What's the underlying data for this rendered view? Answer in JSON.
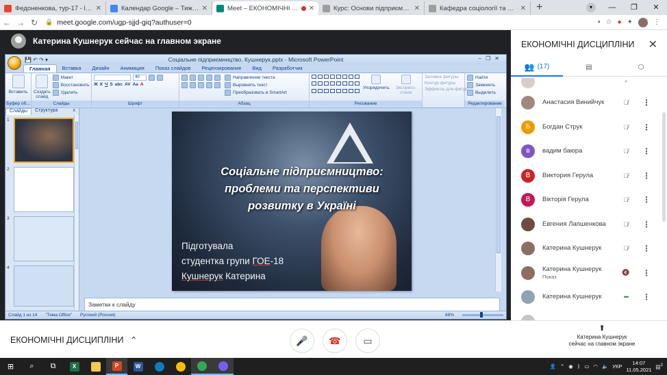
{
  "browser": {
    "tabs": [
      {
        "title": "Федоненкова, тур-17 - ludmila.b",
        "color": "#ea4335",
        "active": false
      },
      {
        "title": "Календар Google – Тиждень (10",
        "color": "#4285f4",
        "active": false
      },
      {
        "title": "Meet – ЕКОНОМІЧНІ ДИСЦ",
        "color": "#00897b",
        "active": true
      },
      {
        "title": "Курс: Основи підприємницької",
        "color": "#9e9e9e",
        "active": false
      },
      {
        "title": "Кафедра соціології та масових",
        "color": "#9e9e9e",
        "active": false
      }
    ],
    "new_tab": "+",
    "url": "meet.google.com/ugp-sjjd-giq?authuser=0"
  },
  "meet": {
    "presenter_banner": "Катерина Кушнерук сейчас на главном экране",
    "meeting_name": "ЕКОНОМІЧНІ ДИСЦИПЛІНИ",
    "present_label_line1": "Катерина Кушнерук",
    "present_label_line2": "сейчас на главном экране"
  },
  "ppt": {
    "window_title": "Соціальне підприємництво. Кушнерук.pptx - Microsoft PowerPoint",
    "tabs": [
      "Главная",
      "Вставка",
      "Дизайн",
      "Анимация",
      "Показ слайдов",
      "Рецензирование",
      "Вид",
      "Разработчик"
    ],
    "groups": {
      "clipboard": "Буфер об...",
      "slides": "Слайды",
      "font": "Шрифт",
      "paragraph": "Абзац",
      "drawing": "Рисование",
      "editing": "Редактирование"
    },
    "buttons": {
      "paste": "Вставить",
      "create_slide": "Создать слайд",
      "layout": "Макет",
      "reset": "Восстановить",
      "delete": "Удалить",
      "font_size": "40",
      "text_dir": "Направление текста",
      "align_text": "Выровнять текст",
      "smartart": "Преобразовать в SmartArt",
      "arrange": "Упорядочить",
      "quick_styles": "Экспресс-стили",
      "fill": "Заливка фигуры",
      "outline": "Контур фигуры",
      "effects": "Эффекты для фигур",
      "find": "Найти",
      "replace": "Заменить",
      "select": "Выделить"
    },
    "pane_tabs": [
      "Слайды",
      "Структура"
    ],
    "pane_close": "x",
    "thumb_numbers": [
      "1",
      "2",
      "3",
      "4"
    ],
    "slide": {
      "title_lines": [
        "Соціальне підприємництво:",
        "проблеми та перспективи",
        "розвитку в Україні"
      ],
      "sub_line1": "Підготувала",
      "sub_line2_a": "студентка групи ",
      "sub_line2_b": "ГОЕ",
      "sub_line2_c": "-18",
      "sub_line3_a": "Кушнерук",
      "sub_line3_b": " Катерина"
    },
    "notes_placeholder": "Заметки к слайду",
    "status": {
      "slide_of": "Слайд 1 из 14",
      "theme": "\"Тема Office\"",
      "language": "Русский (Россия)",
      "zoom": "68%"
    }
  },
  "sidebar": {
    "title": "ЕКОНОМІЧНІ ДИСЦИПЛІНИ",
    "people_count": "(17)",
    "participants": [
      {
        "initial": "",
        "name": "Анастасия Винийчук",
        "sub": "",
        "color": "#a1887f",
        "mic": "muted"
      },
      {
        "initial": "Б",
        "name": "Богдан Струк",
        "sub": "",
        "color": "#f29900",
        "mic": "muted"
      },
      {
        "initial": "в",
        "name": "вадим баюра",
        "sub": "",
        "color": "#7e57c2",
        "mic": "muted"
      },
      {
        "initial": "В",
        "name": "Виктория Герула",
        "sub": "",
        "color": "#c62828",
        "mic": "muted"
      },
      {
        "initial": "В",
        "name": "Вікторія Герула",
        "sub": "",
        "color": "#c2185b",
        "mic": "muted"
      },
      {
        "initial": "",
        "name": "Евгения Лапшенкова",
        "sub": "",
        "color": "#6d4c41",
        "mic": "muted"
      },
      {
        "initial": "",
        "name": "Катерина Кушнерук",
        "sub": "",
        "color": "#8d6e63",
        "mic": "muted"
      },
      {
        "initial": "",
        "name": "Катерина Кушнерук",
        "sub": "Показ",
        "color": "#8d6e63",
        "mic": "present"
      },
      {
        "initial": "",
        "name": "Катерина Кушнерук",
        "sub": "",
        "color": "#90a4ae",
        "mic": "talking"
      }
    ]
  },
  "taskbar": {
    "lang": "УКР",
    "time": "14:07",
    "date": "11.05.2021",
    "notif_count": "2"
  }
}
